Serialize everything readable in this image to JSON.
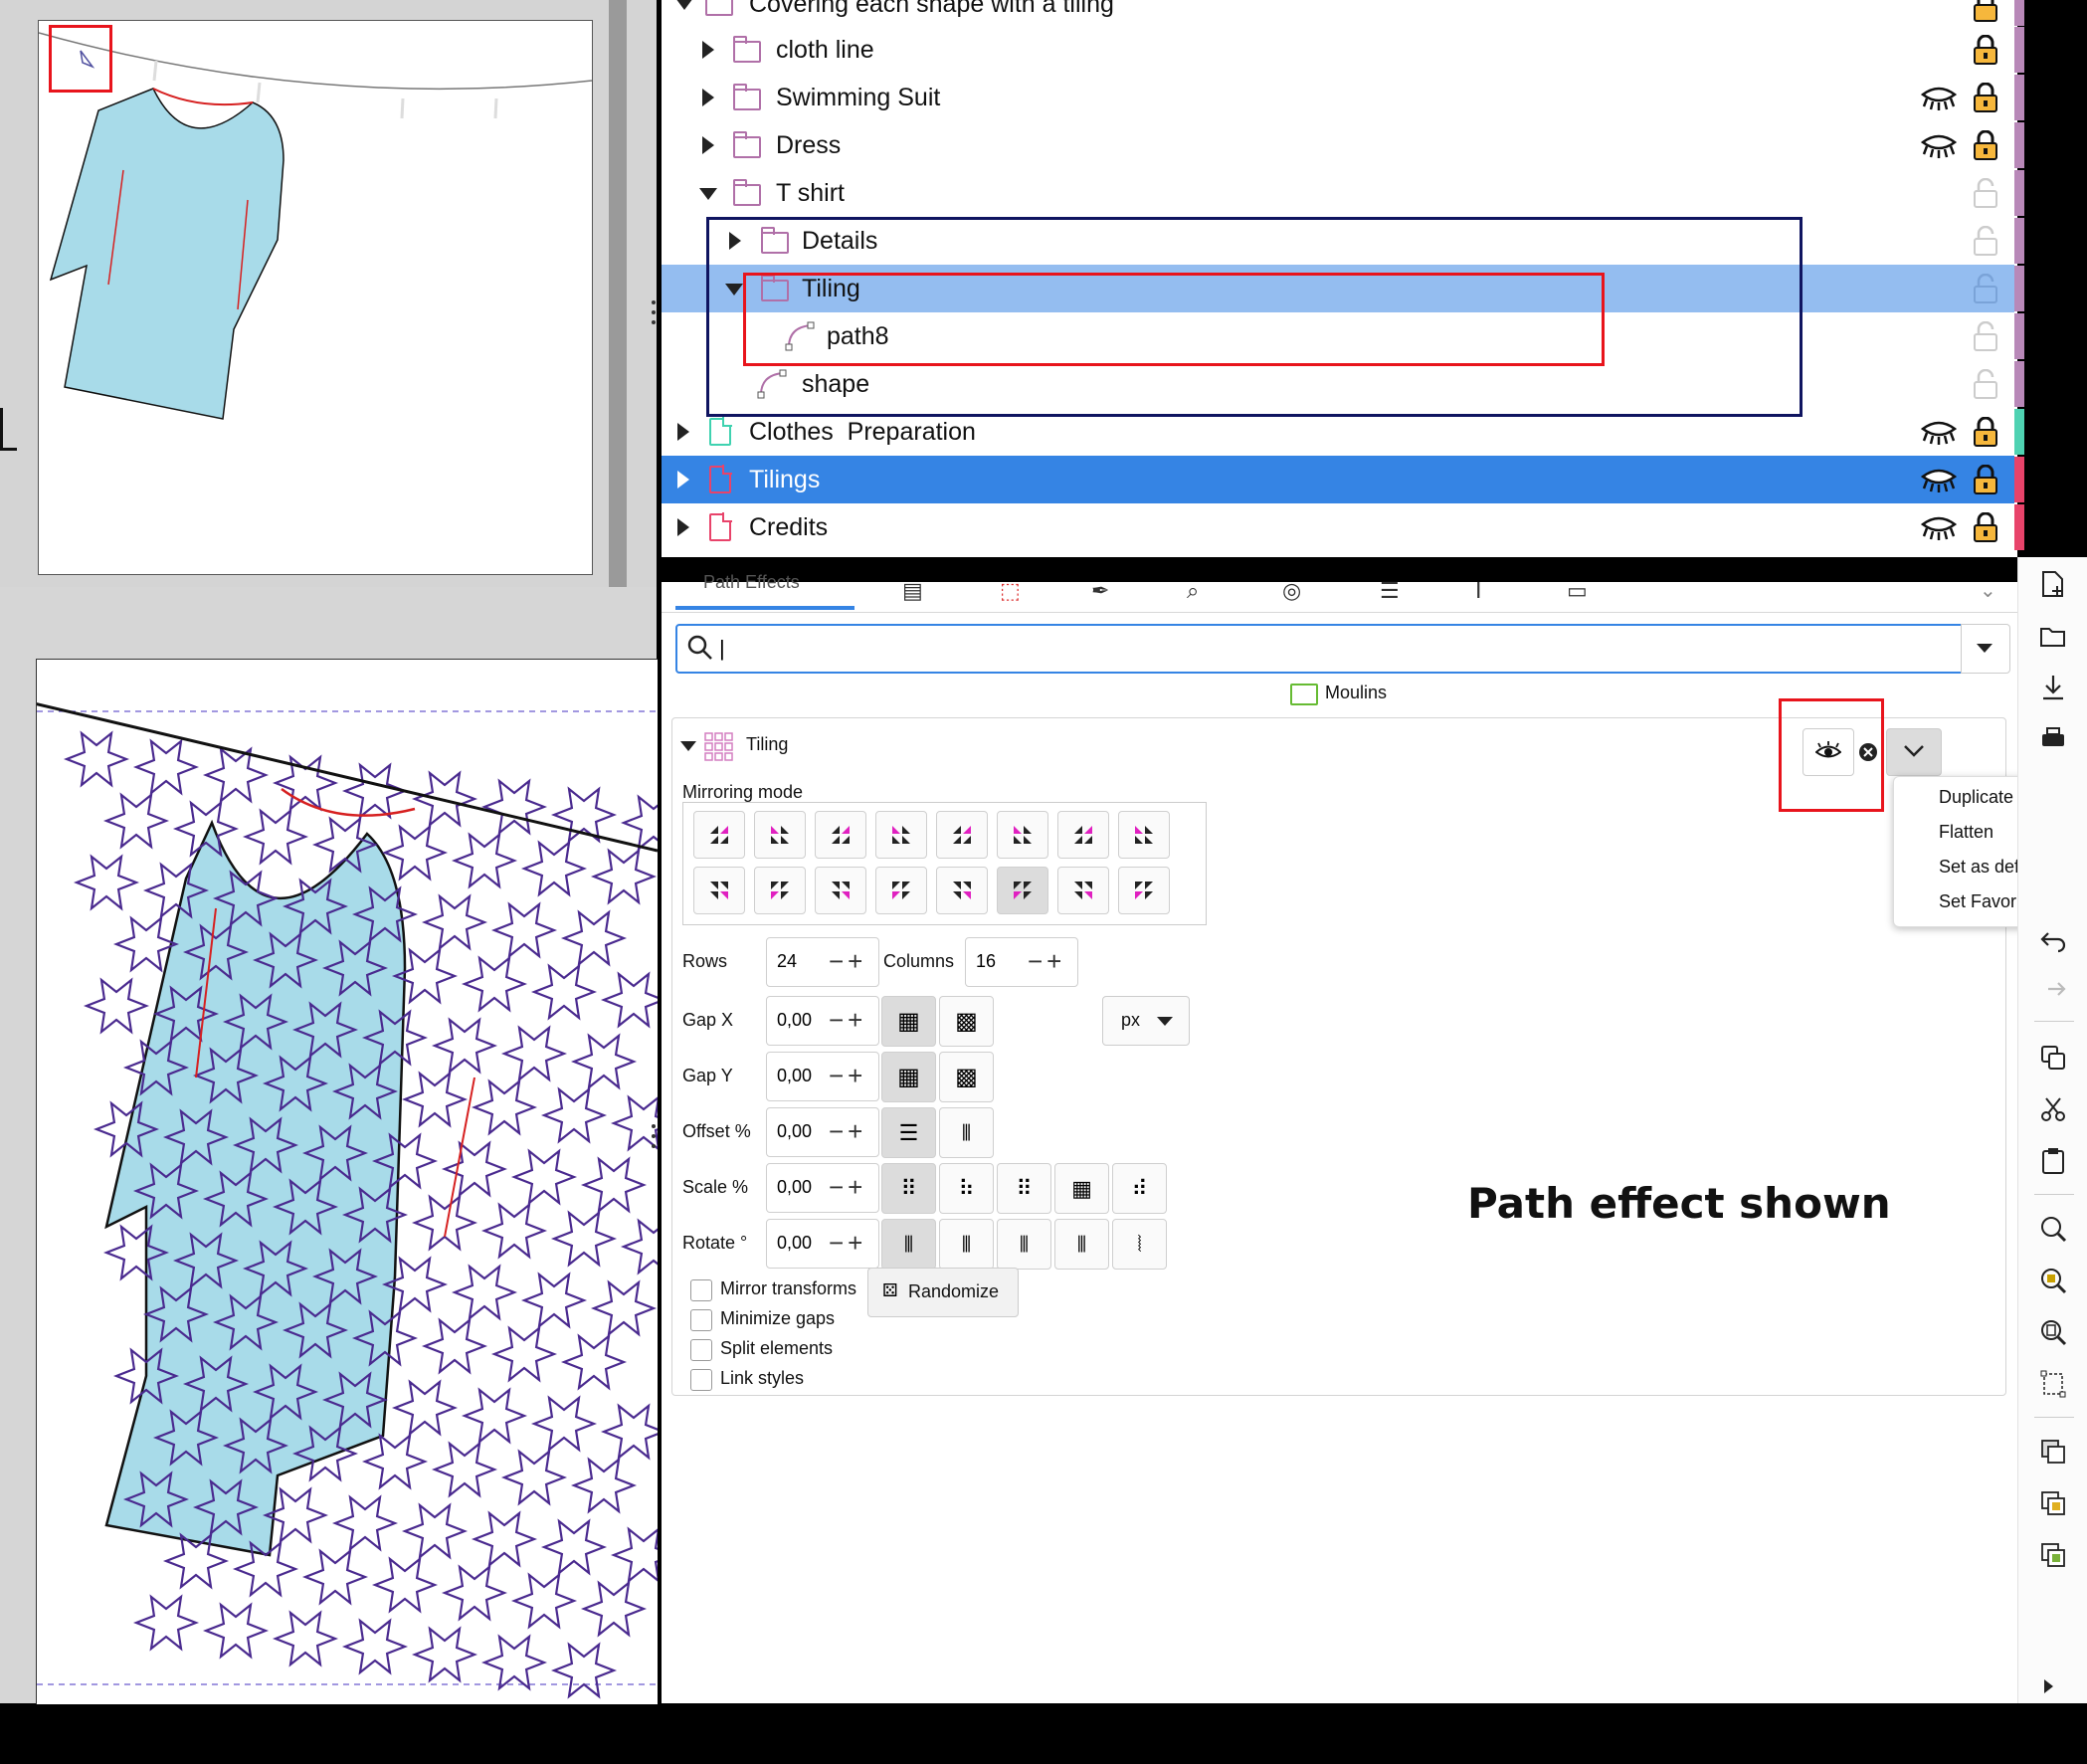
{
  "layers": {
    "rows": [
      {
        "label": "Covering each shape with a tiling"
      },
      {
        "label": "cloth line"
      },
      {
        "label": "Swimming Suit"
      },
      {
        "label": "Dress"
      },
      {
        "label": "T shirt"
      },
      {
        "label": "Details"
      },
      {
        "label": "Tiling"
      },
      {
        "label": "path8"
      },
      {
        "label": "shape"
      },
      {
        "label": "Clothes  Preparation"
      },
      {
        "label": "Tilings"
      },
      {
        "label": "Credits"
      }
    ]
  },
  "path_effects": {
    "tab_label": "Path Effects",
    "search_value": "|",
    "group_label": "Moulins",
    "effect_name": "Tiling",
    "mirroring_label": "Mirroring mode",
    "rows_label": "Rows",
    "rows_value": "24",
    "columns_label": "Columns",
    "columns_value": "16",
    "gapx_label": "Gap X",
    "gapx_value": "0,00",
    "gapy_label": "Gap Y",
    "gapy_value": "0,00",
    "offset_label": "Offset %",
    "offset_value": "0,00",
    "scale_label": "Scale %",
    "scale_value": "0,00",
    "rotate_label": "Rotate °",
    "rotate_value": "0,00",
    "unit": "px",
    "checkboxes": [
      {
        "label": "Mirror transforms"
      },
      {
        "label": "Minimize gaps"
      },
      {
        "label": "Split elements"
      },
      {
        "label": "Link styles"
      }
    ],
    "randomize_label": "Randomize",
    "menu": [
      "Duplicate",
      "Flatten",
      "Set as default",
      "Set Favorite"
    ]
  },
  "annotation": "Path effect shown",
  "colors": {
    "selection_light": "#94bdf0",
    "selection_dark": "#3584e4",
    "folder": "#b070a8",
    "highlight_red": "#e8141c",
    "highlight_navy": "#0f1460",
    "tshirt_fill": "#a8dbe9",
    "tiling_stroke": "#4a2a8f"
  }
}
